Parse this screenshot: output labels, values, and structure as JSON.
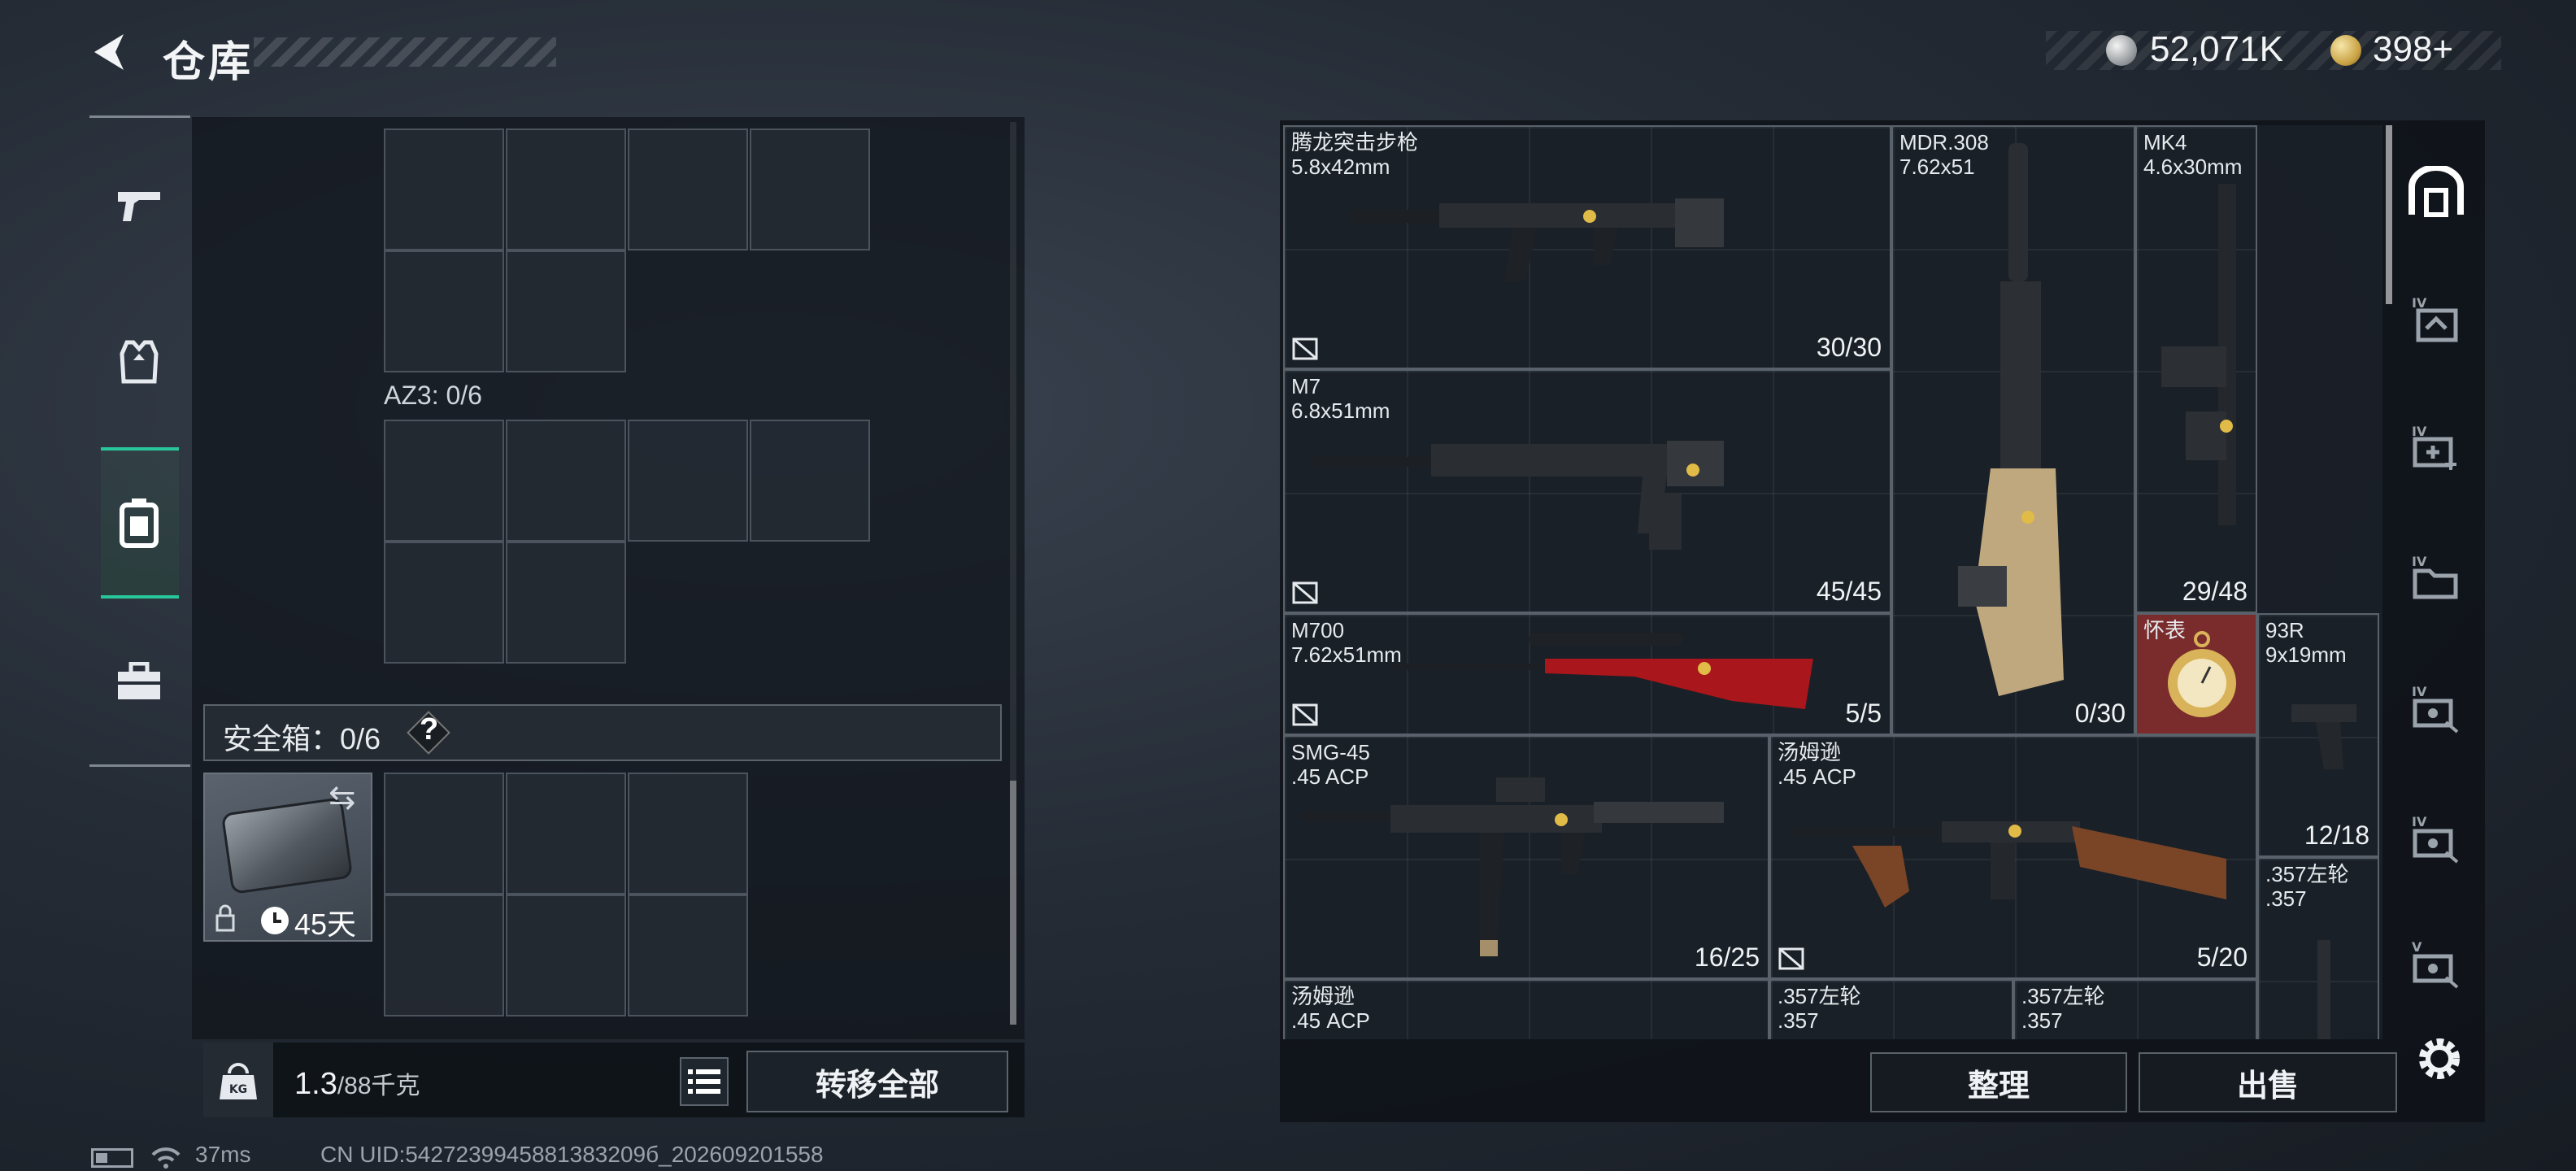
{
  "header": {
    "title": "仓库",
    "currency": {
      "silver": "52,071K",
      "gold": "398",
      "gold_plus": "+"
    }
  },
  "sidebar": {
    "tabs": [
      {
        "icon": "pistol-icon",
        "active": false
      },
      {
        "icon": "armor-vest-icon",
        "active": false
      },
      {
        "icon": "backpack-icon",
        "active": true
      },
      {
        "icon": "toolbox-icon",
        "active": false
      }
    ]
  },
  "left_panel": {
    "container_label": "AZ3: 0/6",
    "safe_label": "安全箱：0/6",
    "help": "?",
    "safe_item_days": "45天",
    "weight_current": "1.3",
    "weight_max": "/88千克",
    "transfer_all": "转移全部"
  },
  "stash": {
    "items": [
      {
        "name": "腾龙突击步枪",
        "ammo": "5.8x42mm",
        "count": "30/30"
      },
      {
        "name": "MDR.308",
        "ammo": "7.62x51",
        "count": "0/30"
      },
      {
        "name": "MK4",
        "ammo": "4.6x30mm",
        "count": "29/48"
      },
      {
        "name": "M7",
        "ammo": "6.8x51mm",
        "count": "45/45"
      },
      {
        "name": "M700",
        "ammo": "7.62x51mm",
        "count": "5/5"
      },
      {
        "name": "怀表",
        "ammo": "",
        "count": ""
      },
      {
        "name": "93R",
        "ammo": "9x19mm",
        "count": "12/18"
      },
      {
        "name": "SMG-45",
        "ammo": ".45 ACP",
        "count": "16/25"
      },
      {
        "name": "汤姆逊",
        "ammo": ".45 ACP",
        "count": "5/20"
      },
      {
        "name": ".357左轮",
        "ammo": ".357",
        "count": ""
      },
      {
        "name": "汤姆逊",
        "ammo": ".45 ACP",
        "count": ""
      },
      {
        "name": ".357左轮",
        "ammo": ".357",
        "count": ""
      },
      {
        "name": ".357左轮",
        "ammo": ".357",
        "count": ""
      }
    ],
    "sort_label": "整理",
    "sell_label": "出售"
  },
  "status": {
    "ping": "37ms",
    "uid": "CN UID:5427239945881383209б_202609201558"
  }
}
